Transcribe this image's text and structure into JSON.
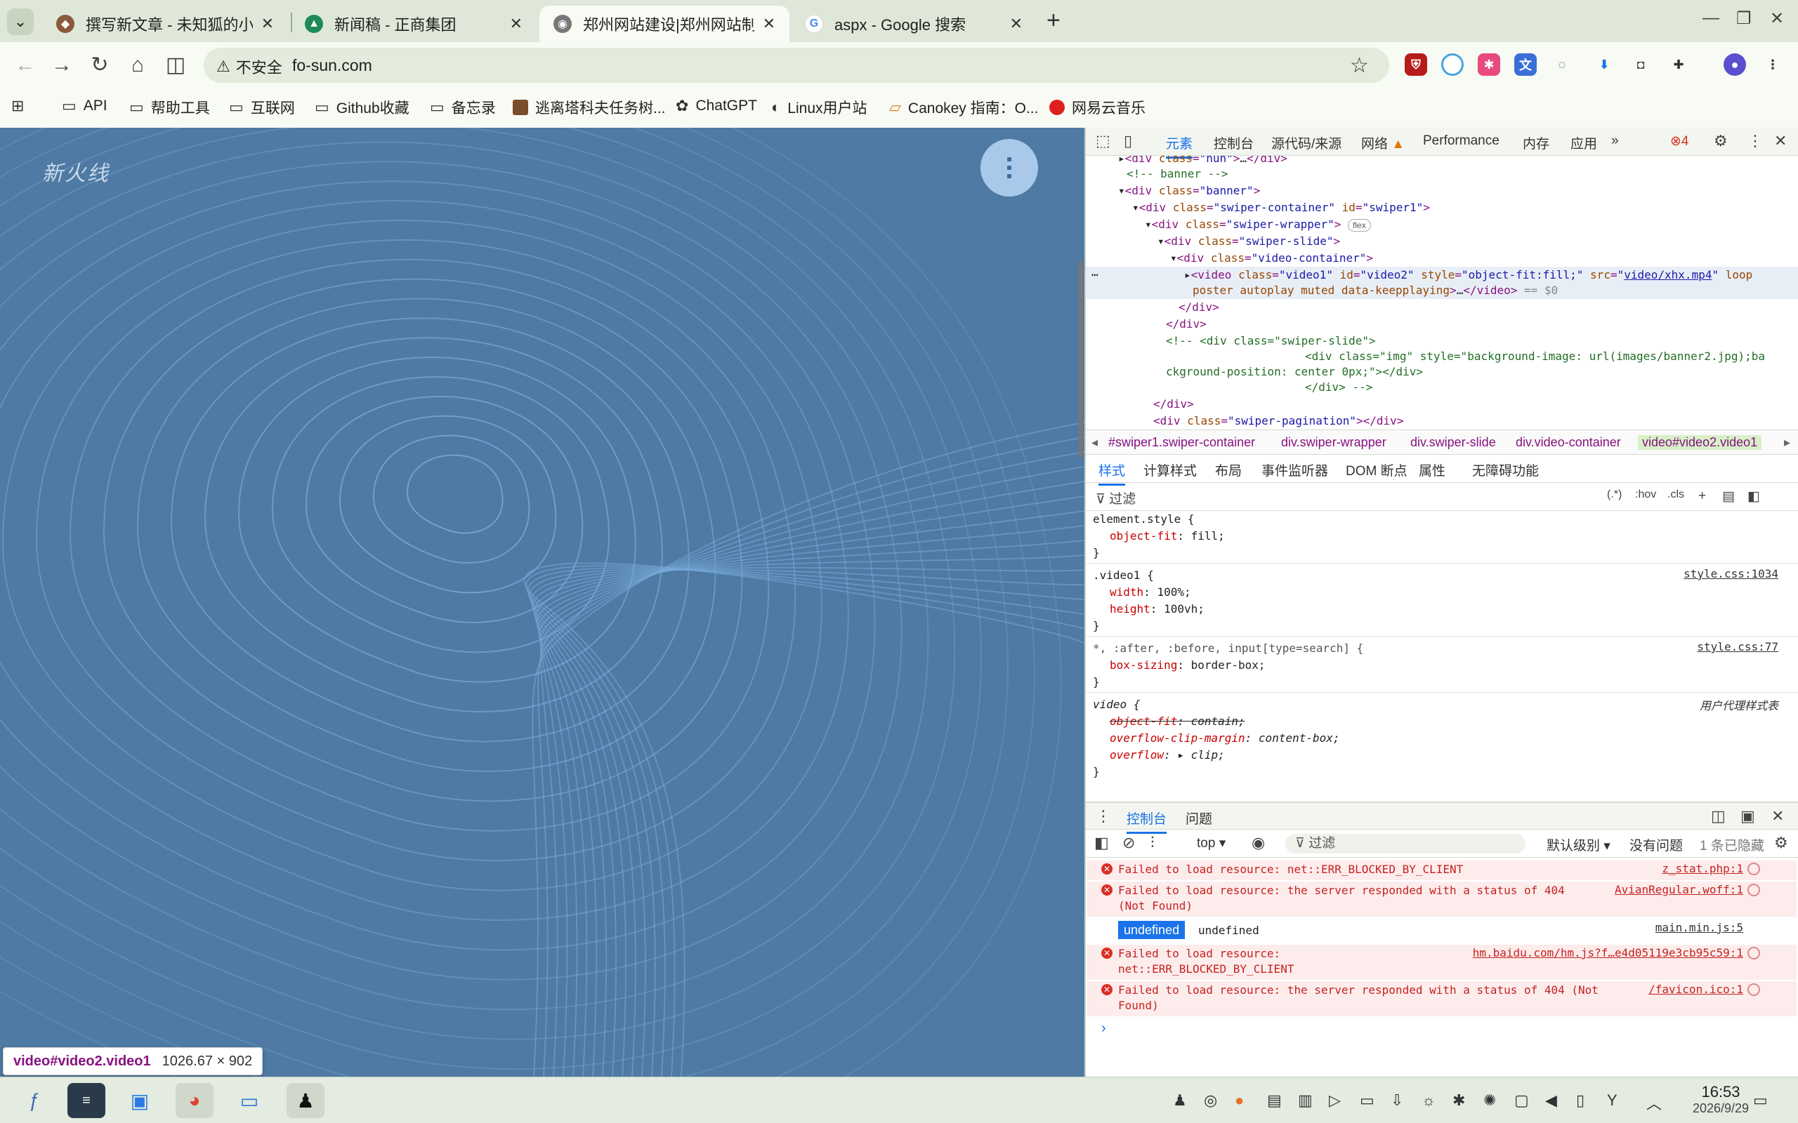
{
  "browser": {
    "tabs": [
      {
        "title": "撰写新文章 - 未知狐的小窝 -",
        "active": false
      },
      {
        "title": "新闻稿 - 正商集团",
        "active": false
      },
      {
        "title": "郑州网站建设|郑州网站制作",
        "active": true
      },
      {
        "title": "aspx - Google 搜索",
        "active": false
      }
    ],
    "security_label": "不安全",
    "url": "fo-sun.com",
    "bookmarks": [
      "API",
      "帮助工具",
      "互联网",
      "Github收藏",
      "备忘录",
      "逃离塔科夫任务树...",
      "ChatGPT",
      "Linux用户站",
      "Canokey 指南：O...",
      "网易云音乐"
    ]
  },
  "page": {
    "logo_text": "新火线",
    "inspect_tooltip": {
      "selector": "video#video2.video1",
      "size": "1026.67 × 902"
    }
  },
  "devtools": {
    "tabs": [
      "元素",
      "控制台",
      "源代码/来源",
      "网络",
      "Performance",
      "内存",
      "应用"
    ],
    "error_count": "4",
    "breadcrumbs": [
      "#swiper1.swiper-container",
      "div.swiper-wrapper",
      "div.swiper-slide",
      "div.video-container",
      "video#video2.video1"
    ],
    "styles_tabs": [
      "样式",
      "计算样式",
      "布局",
      "事件监听器",
      "DOM 断点",
      "属性",
      "无障碍功能"
    ],
    "filter_placeholder": "过滤",
    "filter_tools": [
      ":hov",
      ".cls"
    ],
    "rules": {
      "r1_selector": "element.style {",
      "r1_prop": "object-fit",
      "r1_val": "fill;",
      "r2_selector": ".video1 {",
      "r2_src": "style.css:1034",
      "r2_p1": "width",
      "r2_v1": "100%;",
      "r2_p2": "height",
      "r2_v2": "100vh;",
      "r3_selector": "*, :after, :before, input[type=search] {",
      "r3_src": "style.css:77",
      "r3_p1": "box-sizing",
      "r3_v1": "border-box;",
      "r4_selector": "video {",
      "r4_src": "用户代理样式表",
      "r4_p1": "object-fit",
      "r4_v1": "contain;",
      "r4_p2": "overflow-clip-margin",
      "r4_v2": "content-box;",
      "r4_p3": "overflow",
      "r4_v3": "clip;",
      "close_brace": "}"
    },
    "console": {
      "tabs": [
        "控制台",
        "问题"
      ],
      "context": "top",
      "filter_placeholder": "过滤",
      "level": "默认级别",
      "issues": "没有问题",
      "hidden": "1 条已隐藏",
      "messages": [
        {
          "text": "Failed to load resource: net::ERR_BLOCKED_BY_CLIENT",
          "src": "z_stat.php:1"
        },
        {
          "text": "Failed to load resource: the server responded with a status of 404 (Not Found)",
          "src": "AvianRegular.woff:1"
        },
        {
          "text": "undefined",
          "src": "main.min.js:5"
        },
        {
          "text": "Failed to load resource: net::ERR_BLOCKED_BY_CLIENT",
          "src": "hm.baidu.com/hm.js?f…e4d05119e3cb95c59:1"
        },
        {
          "text": "Failed to load resource: the server responded with a status of 404 (Not Found)",
          "src": "/favicon.ico:1"
        }
      ],
      "undefined_badge": "undefined"
    }
  },
  "taskbar": {
    "time": "16:53",
    "date": "2026/9/29"
  }
}
